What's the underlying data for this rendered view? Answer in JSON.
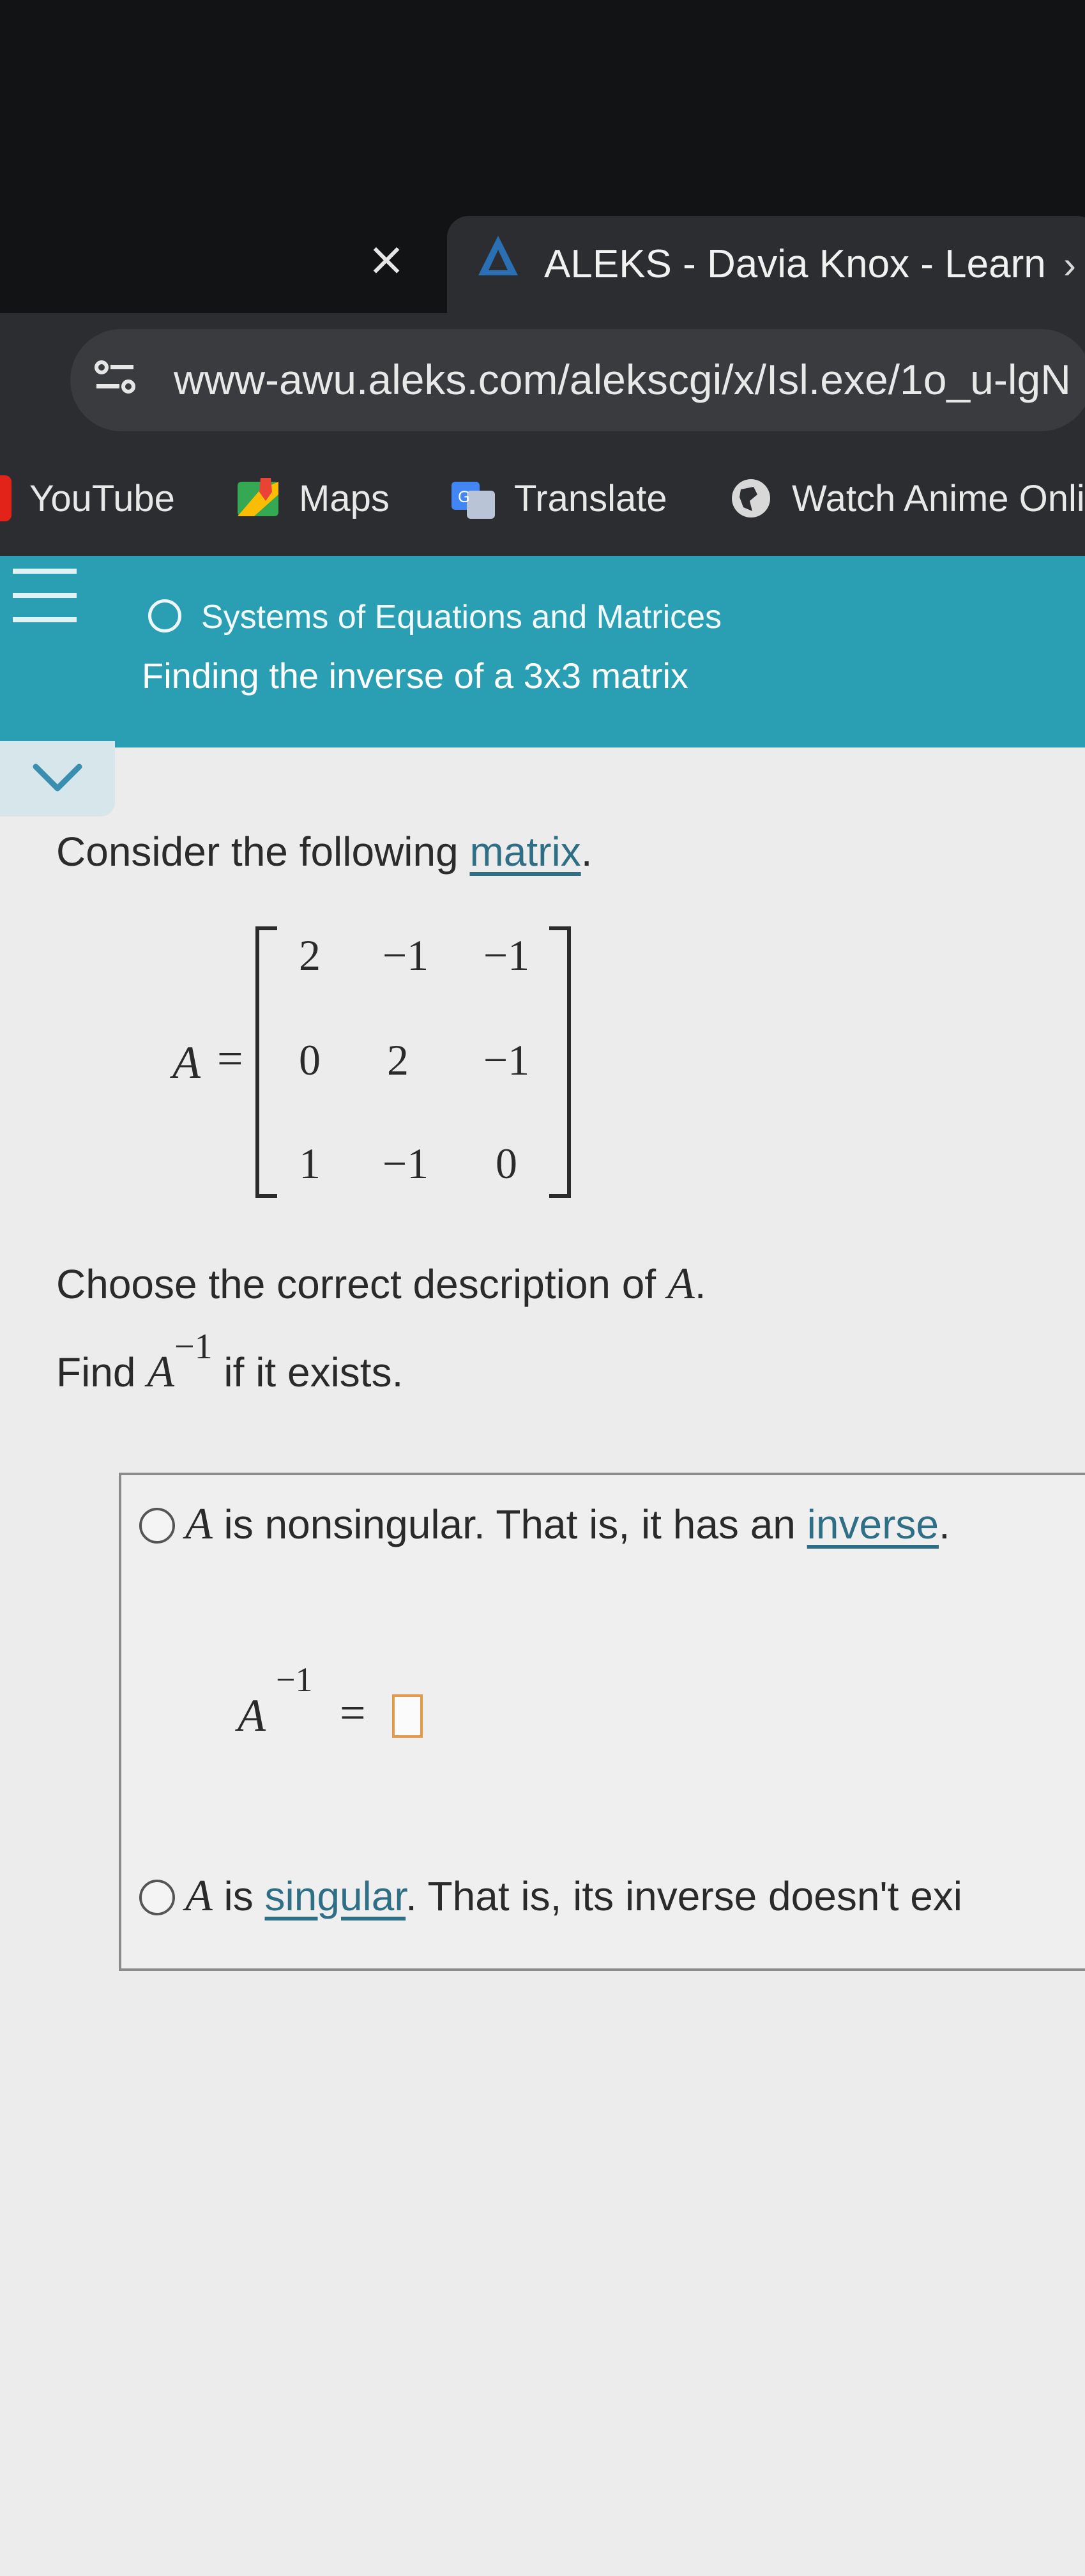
{
  "browser": {
    "tab_close": "×",
    "tab_title": "ALEKS - Davia Knox - Learn",
    "tab_more": "›",
    "url": "www-awu.aleks.com/alekscgi/x/Isl.exe/1o_u-lgN",
    "bookmarks": [
      {
        "label": "YouTube",
        "icon": "youtube-icon"
      },
      {
        "label": "Maps",
        "icon": "maps-icon"
      },
      {
        "label": "Translate",
        "icon": "translate-icon"
      },
      {
        "label": "Watch Anime Onli",
        "icon": "globe-icon"
      }
    ]
  },
  "header": {
    "topic": "Systems of Equations and Matrices",
    "subtopic": "Finding the inverse of a 3x3 matrix",
    "accent_color": "#2a9fb3"
  },
  "problem": {
    "intro_text": "Consider the following ",
    "intro_link": "matrix",
    "intro_end": ".",
    "matrix_name": "A",
    "equals": "=",
    "matrix": [
      [
        "2",
        "−1",
        "−1"
      ],
      [
        "0",
        "2",
        "−1"
      ],
      [
        "1",
        "−1",
        "0"
      ]
    ],
    "choose_text": "Choose the correct description of ",
    "choose_var": "A",
    "choose_end": ".",
    "find_text": "Find ",
    "find_var": "A",
    "find_sup": "−1",
    "find_end": " if it exists."
  },
  "options": {
    "nonsingular": {
      "var": "A",
      "text_before": " is nonsingular. That is, it has an ",
      "link": "inverse",
      "text_after": "."
    },
    "inverse_expr": {
      "var": "A",
      "sup": "−1",
      "equals": "="
    },
    "singular": {
      "var": "A",
      "text_before": " is ",
      "link": "singular",
      "text_after": ". That is, its inverse doesn't exi"
    }
  }
}
